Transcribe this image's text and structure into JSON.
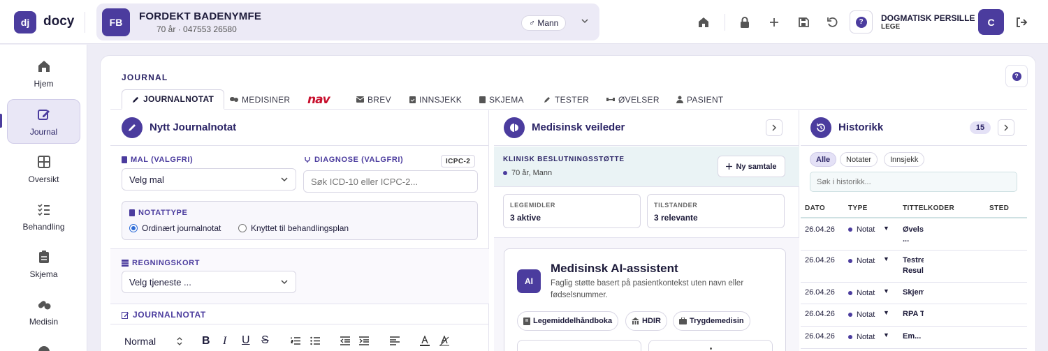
{
  "app": {
    "logo_initials": "dj",
    "name": "docy"
  },
  "patient": {
    "initials": "FB",
    "name": "FORDEKT BADENYMFE",
    "info": "70 år · 047553 26580",
    "gender": "♂ Mann"
  },
  "user": {
    "name": "DOGMATISK PERSILLE",
    "role": "LEGE",
    "initial": "C"
  },
  "colors": {
    "accent": "#4b3c9e",
    "nav_red": "#c8102e"
  },
  "sidebar": {
    "items": [
      {
        "label": "Hjem",
        "icon": "home-icon"
      },
      {
        "label": "Journal",
        "icon": "edit-icon"
      },
      {
        "label": "Oversikt",
        "icon": "grid-icon"
      },
      {
        "label": "Behandling",
        "icon": "list-check-icon"
      },
      {
        "label": "Skjema",
        "icon": "clipboard-icon"
      },
      {
        "label": "Medisin",
        "icon": "pills-icon"
      }
    ]
  },
  "main": {
    "section_label": "JOURNAL",
    "tabs": [
      "JOURNALNOTAT",
      "MEDISINER",
      "nav",
      "BREV",
      "INNSJEKK",
      "SKJEMA",
      "TESTER",
      "ØVELSER",
      "PASIENT"
    ]
  },
  "note": {
    "title": "Nytt Journalnotat",
    "mal_label": "MAL (VALGFRI)",
    "mal_value": "Velg mal",
    "diag_label": "DIAGNOSE (VALGFRI)",
    "diag_chip": "ICPC-2",
    "diag_placeholder": "Søk ICD-10 eller ICPC-2...",
    "notattype_label": "NOTATTYPE",
    "radio1": "Ordinært journalnotat",
    "radio2": "Knyttet til behandlingsplan",
    "regning_label": "REGNINGSKORT",
    "regning_value": "Velg tjeneste ...",
    "journalnotat_label": "JOURNALNOTAT",
    "format_value": "Normal"
  },
  "guide": {
    "title": "Medisinsk veileder",
    "kbs_label": "KLINISK BESLUTNINGSSTØTTE",
    "kbs_patient": "70 år, Mann",
    "new_chat": "Ny samtale",
    "stat1_label": "LEGEMIDLER",
    "stat1_value": "3 aktive",
    "stat2_label": "TILSTANDER",
    "stat2_value": "3 relevante",
    "ai_badge": "AI",
    "ai_title": "Medisinsk AI-assistent",
    "ai_desc": "Faglig støtte basert på pasientkontekst uten navn eller fødselsnummer.",
    "sources": [
      "Legemiddelhåndboka",
      "HDIR",
      "Trygdemedisin"
    ]
  },
  "history": {
    "title": "Historikk",
    "count": "15",
    "filters": [
      "Alle",
      "Notater",
      "Innsjekk"
    ],
    "search_placeholder": "Søk i historikk...",
    "columns": [
      "DATO",
      "TYPE",
      "TITTEL",
      "KODER",
      "STED"
    ],
    "rows": [
      {
        "date": "26.04.26",
        "type": "Notat",
        "title": "Øvelse",
        "title2": "..."
      },
      {
        "date": "26.04.26",
        "type": "Notat",
        "title": "Testre",
        "title2": "Result"
      },
      {
        "date": "26.04.26",
        "type": "Notat",
        "title": "Skjem",
        "title2": ""
      },
      {
        "date": "26.04.26",
        "type": "Notat",
        "title": "RPA TE",
        "title2": ""
      },
      {
        "date": "26.04.26",
        "type": "Notat",
        "title": "Em...",
        "title2": ""
      }
    ]
  }
}
